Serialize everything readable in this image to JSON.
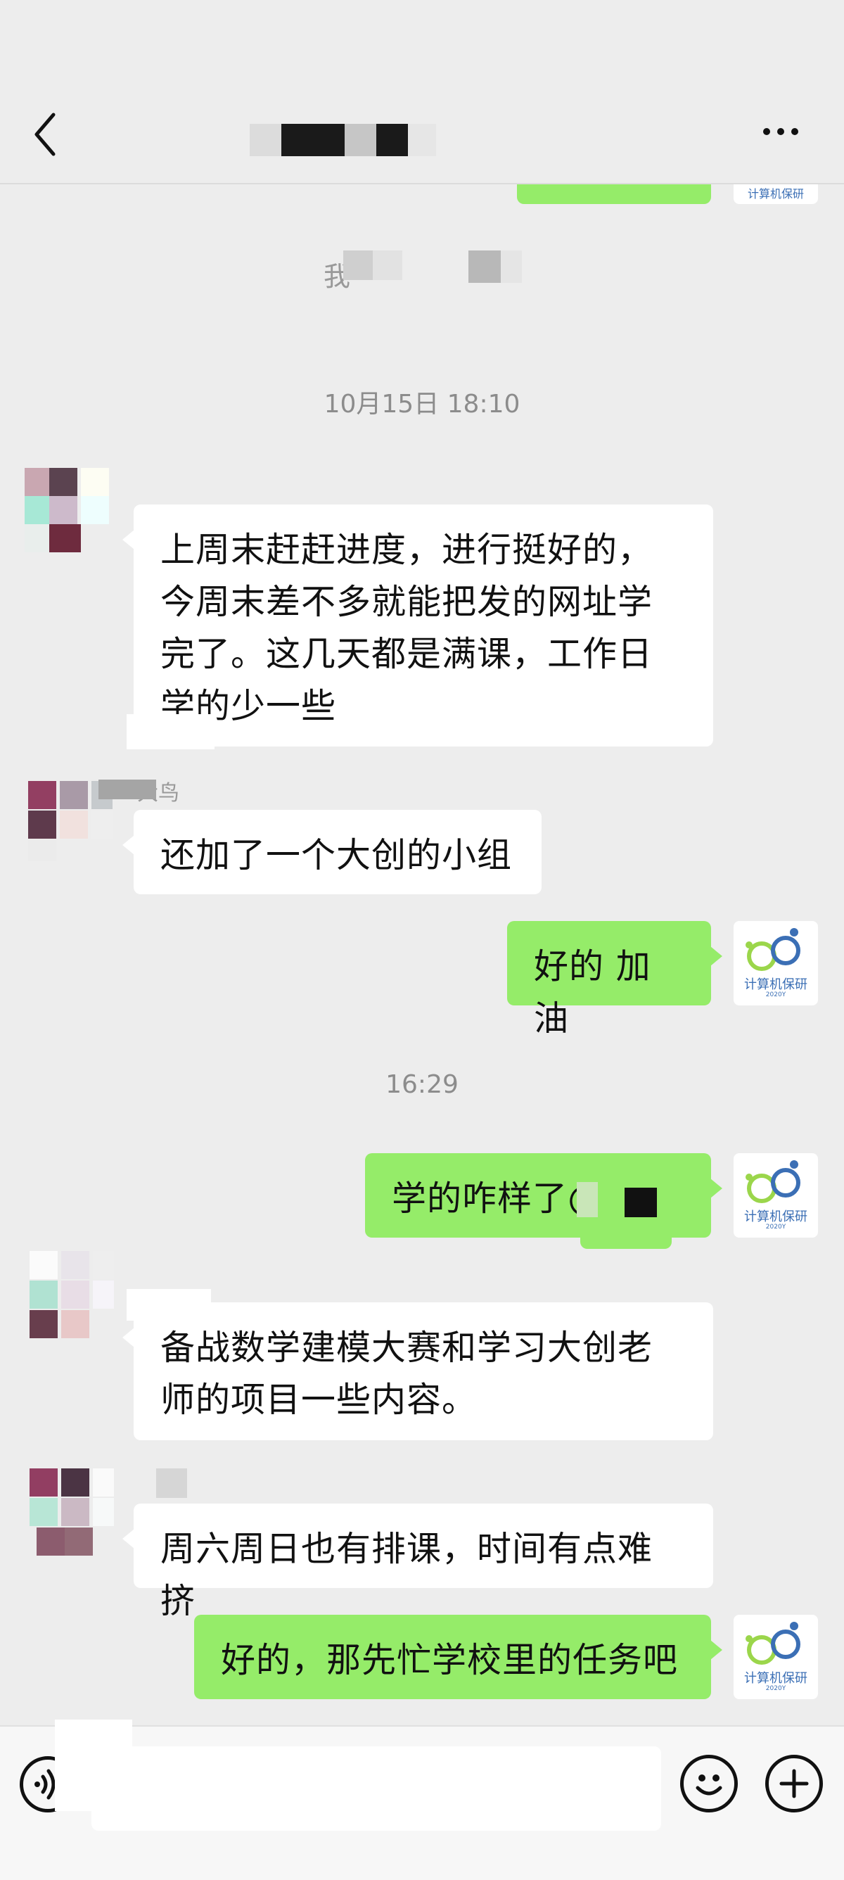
{
  "header": {
    "title": "",
    "back_icon": "chevron-left-icon",
    "more_icon": "more-dots-icon"
  },
  "messages": {
    "top_fragment": "我",
    "timestamp_1": "10月15日 18:10",
    "msg1": "上周末赶赶进度，进行挺好的，今周末差不多就能把发的网址学完了。这几天都是满课，工作日学的少一些",
    "msg2_sender": "大鸟",
    "msg2": "还加了一个大创的小组",
    "msg3": "好的 加油",
    "timestamp_2": "16:29",
    "msg4": "学的咋样了@",
    "msg5": "备战数学建模大赛和学习大创老师的项目一些内容。",
    "msg6": "周六周日也有排课，时间有点难挤",
    "msg7": "好的，那先忙学校里的任务吧"
  },
  "logo": {
    "text": "计算机保研",
    "sub": "2020Y"
  },
  "input_bar": {
    "voice_icon": "voice-icon",
    "emoji_icon": "emoji-icon",
    "plus_icon": "plus-icon",
    "value": ""
  },
  "colors": {
    "background": "#ededed",
    "outgoing_bubble": "#95ec69",
    "incoming_bubble": "#ffffff"
  }
}
